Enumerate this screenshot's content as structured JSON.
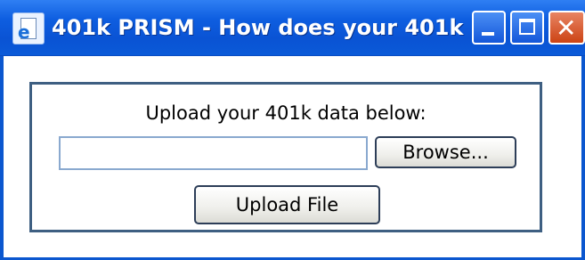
{
  "window": {
    "title": "401k PRISM - How does your 401k ...",
    "icon": "ie-page-icon",
    "controls": [
      "minimize-icon",
      "maximize-icon",
      "close-icon"
    ]
  },
  "form": {
    "prompt": "Upload your 401k data below:",
    "file_input_value": "",
    "browse_label": "Browse...",
    "upload_label": "Upload File"
  },
  "colors": {
    "titlebar": "#0a53d4",
    "panel_border": "#3e5f82",
    "close_button": "#cc4314"
  }
}
